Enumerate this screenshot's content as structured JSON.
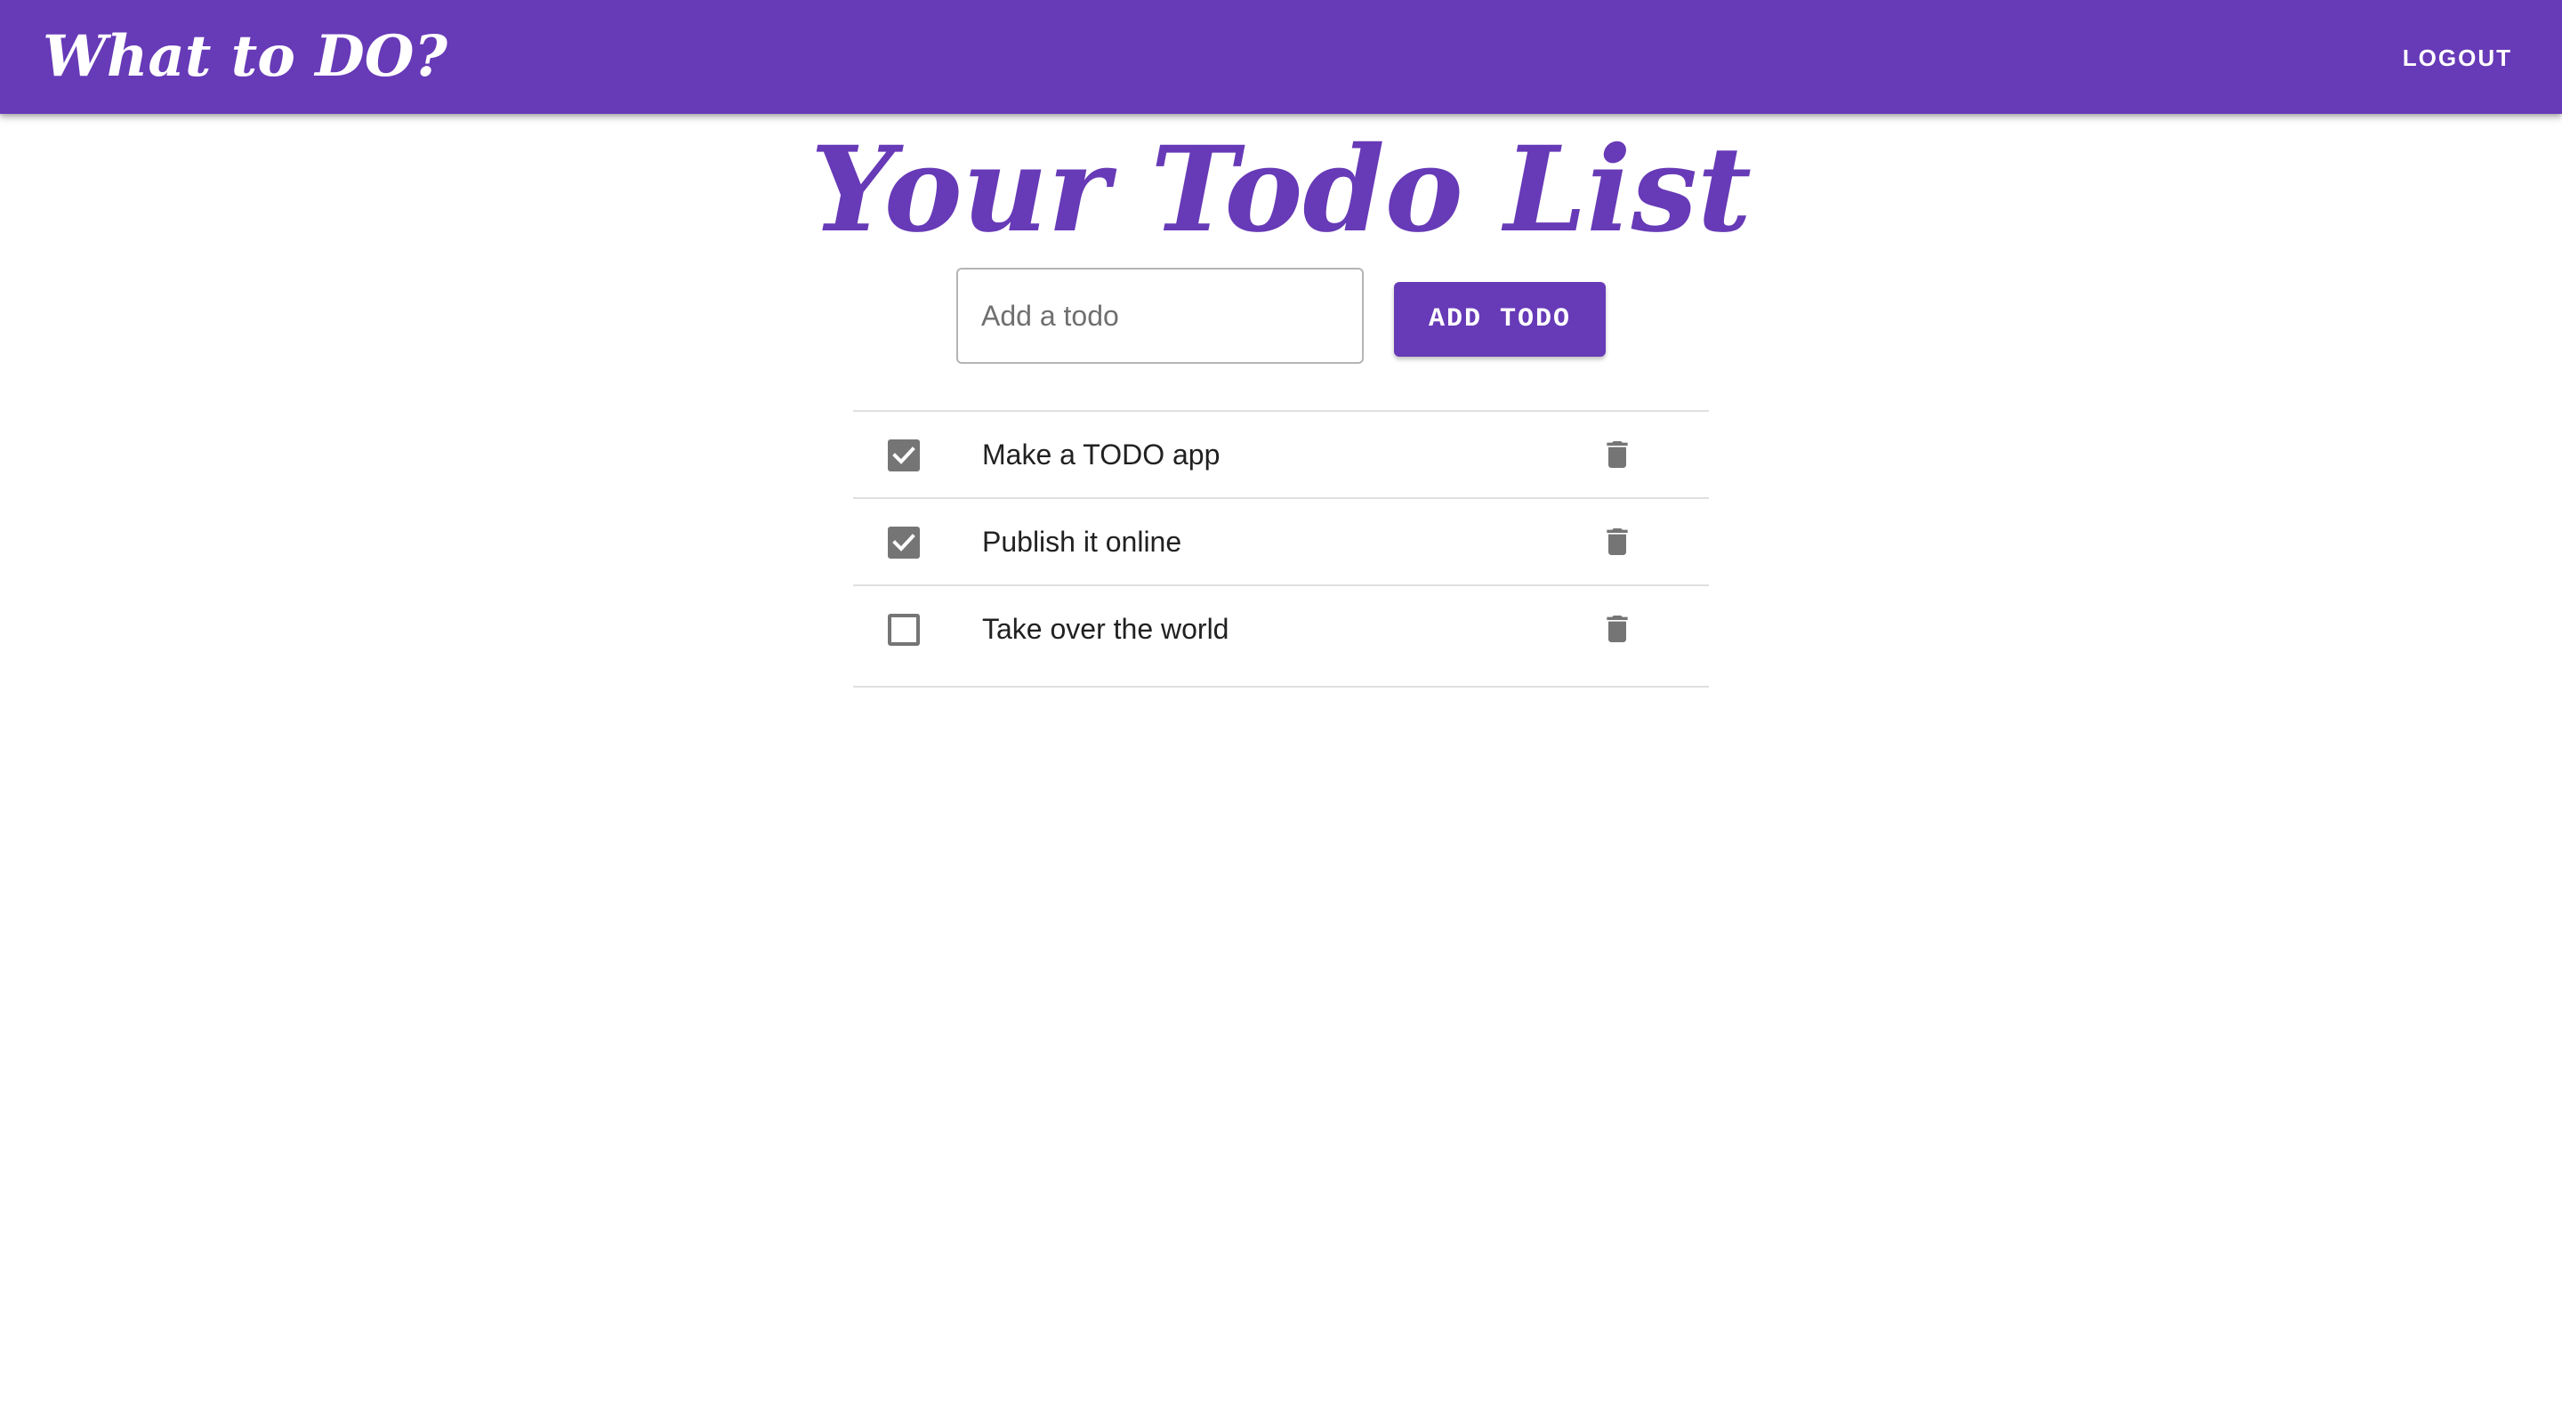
{
  "app": {
    "title": "What to DO?",
    "logout_label": "LOGOUT",
    "accent_color": "#673ab7"
  },
  "main": {
    "heading": "Your Todo List",
    "input": {
      "placeholder": "Add a todo",
      "value": ""
    },
    "add_button_label": "ADD TODO"
  },
  "todos": [
    {
      "text": "Make a TODO app",
      "done": true,
      "delete_icon": "trash-icon"
    },
    {
      "text": "Publish it online",
      "done": true,
      "delete_icon": "trash-icon"
    },
    {
      "text": "Take over the world",
      "done": false,
      "delete_icon": "trash-icon"
    }
  ]
}
